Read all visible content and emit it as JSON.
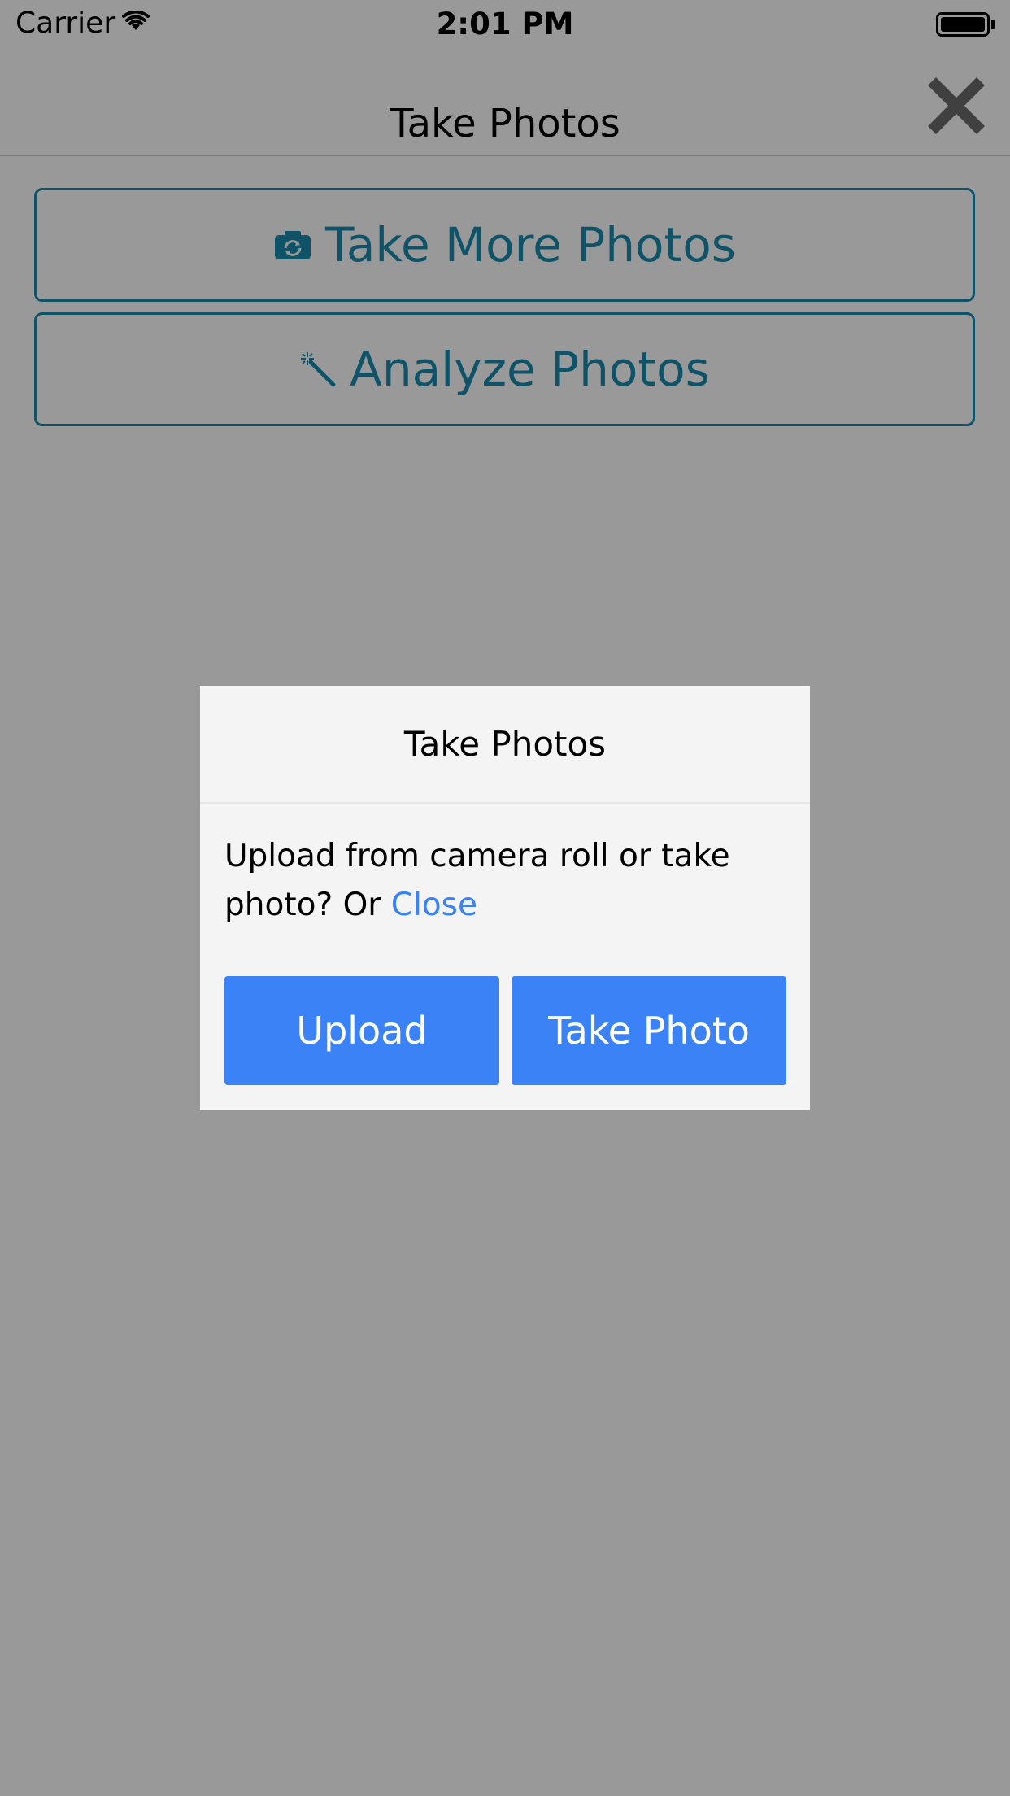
{
  "status_bar": {
    "carrier": "Carrier",
    "time": "2:01 PM"
  },
  "nav": {
    "title": "Take Photos",
    "close_icon": "close-x-icon"
  },
  "actions": {
    "take_more_label": "Take More Photos",
    "take_more_icon": "camera-rotate-icon",
    "analyze_label": "Analyze Photos",
    "analyze_icon": "magic-wand-icon"
  },
  "modal": {
    "title": "Take Photos",
    "message": "Upload from camera roll or take photo? Or ",
    "close_link": "Close",
    "upload_label": "Upload",
    "take_photo_label": "Take Photo"
  },
  "colors": {
    "accent_teal": "#1a8bb0",
    "primary_blue": "#3b82f6",
    "overlay": "rgba(0,0,0,0.4)",
    "modal_bg": "#f4f4f4"
  }
}
